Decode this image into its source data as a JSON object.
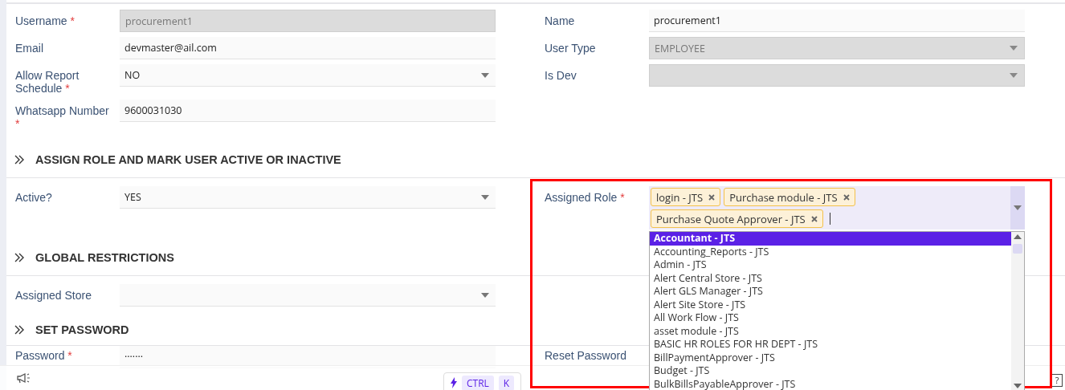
{
  "sections": [
    {
      "rows": [
        {
          "left": {
            "label": "Username",
            "required_mark": "*",
            "kind": "text",
            "value": "procurement1",
            "disabled": true
          },
          "right": {
            "label": "Name",
            "kind": "text",
            "value": "procurement1",
            "disabled": false
          }
        },
        {
          "left": {
            "label": "Email",
            "kind": "text",
            "value": "devmaster@ail.com",
            "disabled": false
          },
          "right": {
            "label": "User Type",
            "kind": "select",
            "value": "EMPLOYEE",
            "disabled": true
          }
        },
        {
          "left": {
            "label": "Allow Report Schedule",
            "required_mark": "*",
            "kind": "select",
            "value": "NO",
            "disabled": false
          },
          "right": {
            "label": "Is Dev",
            "kind": "select",
            "disabled": true
          }
        },
        {
          "left": {
            "label": "Whatsapp Number",
            "required_mark": "*",
            "kind": "text",
            "value": "9600031030",
            "disabled": false
          }
        }
      ]
    },
    {
      "title": "ASSIGN ROLE AND MARK USER ACTIVE OR INACTIVE",
      "rows": [
        {
          "left": {
            "label": "Active?",
            "kind": "select",
            "value": "YES",
            "disabled": false
          },
          "right": {
            "label": "Assigned Role",
            "required_mark": "*",
            "kind": "multiselect",
            "tags": [
              "login - JTS",
              "Purchase module - JTS",
              "Purchase Quote Approver - JTS"
            ],
            "options": [
              {
                "label": "Accountant - JTS",
                "selected": true
              },
              {
                "label": "Accounting_Reports - JTS",
                "selected": false
              },
              {
                "label": "Admin - JTS",
                "selected": false
              },
              {
                "label": "Alert Central Store - JTS",
                "selected": false
              },
              {
                "label": "Alert GLS Manager - JTS",
                "selected": false
              },
              {
                "label": "Alert Site Store - JTS",
                "selected": false
              },
              {
                "label": "All Work Flow - JTS",
                "selected": false
              },
              {
                "label": "asset module - JTS",
                "selected": false
              },
              {
                "label": "BASIC HR ROLES FOR HR DEPT - JTS",
                "selected": false
              },
              {
                "label": "BillPaymentApprover - JTS",
                "selected": false
              },
              {
                "label": "Budget - JTS",
                "selected": false
              },
              {
                "label": "BulkBillsPayableApprover - JTS",
                "selected": false
              }
            ]
          }
        }
      ]
    },
    {
      "title": "GLOBAL RESTRICTIONS",
      "rows": [
        {
          "left": {
            "label": "Assigned Store",
            "kind": "select",
            "disabled": false
          }
        }
      ]
    },
    {
      "title": "SET PASSWORD",
      "rows": [
        {
          "left": {
            "label": "Password",
            "required_mark": "*",
            "kind": "password",
            "value": "·······"
          },
          "right": {
            "label": "Reset Password",
            "kind": "none"
          }
        }
      ]
    }
  ],
  "footer": {
    "keys": [
      "CTRL",
      "K"
    ],
    "help": "?"
  }
}
